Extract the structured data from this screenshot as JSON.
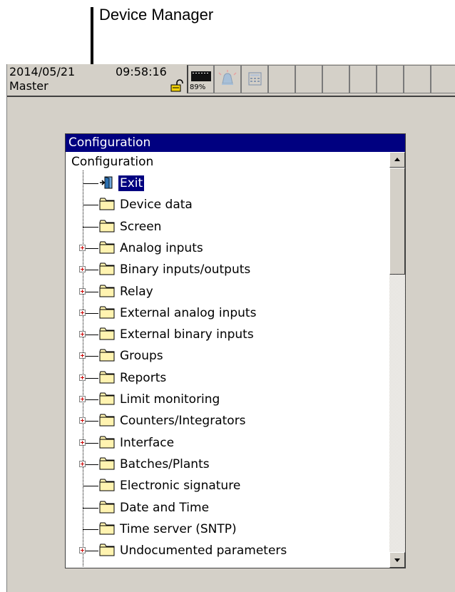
{
  "callout": {
    "label": "Device Manager"
  },
  "status_bar": {
    "date": "2014/05/21",
    "time": "09:58:16",
    "user": "Master",
    "memory_percent": "89%",
    "icons": [
      "memory-icon",
      "alarm-bell-icon",
      "calculator-icon"
    ]
  },
  "window": {
    "title": "Configuration",
    "root_label": "Configuration",
    "selected_item": "Exit",
    "items": [
      {
        "label": "Exit",
        "icon": "exit-door-icon",
        "expandable": false
      },
      {
        "label": "Device data",
        "icon": "folder-icon",
        "expandable": false
      },
      {
        "label": "Screen",
        "icon": "folder-icon",
        "expandable": false
      },
      {
        "label": "Analog inputs",
        "icon": "folder-icon",
        "expandable": true
      },
      {
        "label": "Binary inputs/outputs",
        "icon": "folder-icon",
        "expandable": true
      },
      {
        "label": "Relay",
        "icon": "folder-icon",
        "expandable": true
      },
      {
        "label": "External analog inputs",
        "icon": "folder-icon",
        "expandable": true
      },
      {
        "label": "External binary inputs",
        "icon": "folder-icon",
        "expandable": true
      },
      {
        "label": "Groups",
        "icon": "folder-icon",
        "expandable": true
      },
      {
        "label": "Reports",
        "icon": "folder-icon",
        "expandable": true
      },
      {
        "label": "Limit monitoring",
        "icon": "folder-icon",
        "expandable": true
      },
      {
        "label": "Counters/Integrators",
        "icon": "folder-icon",
        "expandable": true
      },
      {
        "label": "Interface",
        "icon": "folder-icon",
        "expandable": true
      },
      {
        "label": "Batches/Plants",
        "icon": "folder-icon",
        "expandable": true
      },
      {
        "label": "Electronic signature",
        "icon": "folder-icon",
        "expandable": false
      },
      {
        "label": "Date and Time",
        "icon": "folder-icon",
        "expandable": false
      },
      {
        "label": "Time server (SNTP)",
        "icon": "folder-icon",
        "expandable": false
      },
      {
        "label": "Undocumented parameters",
        "icon": "folder-icon",
        "expandable": true
      }
    ]
  },
  "colors": {
    "titlebar": "#000080",
    "selection": "#000080",
    "panel": "#d4d0c8",
    "plus_sign": "#cc0000",
    "folder": "#fff3b0"
  }
}
